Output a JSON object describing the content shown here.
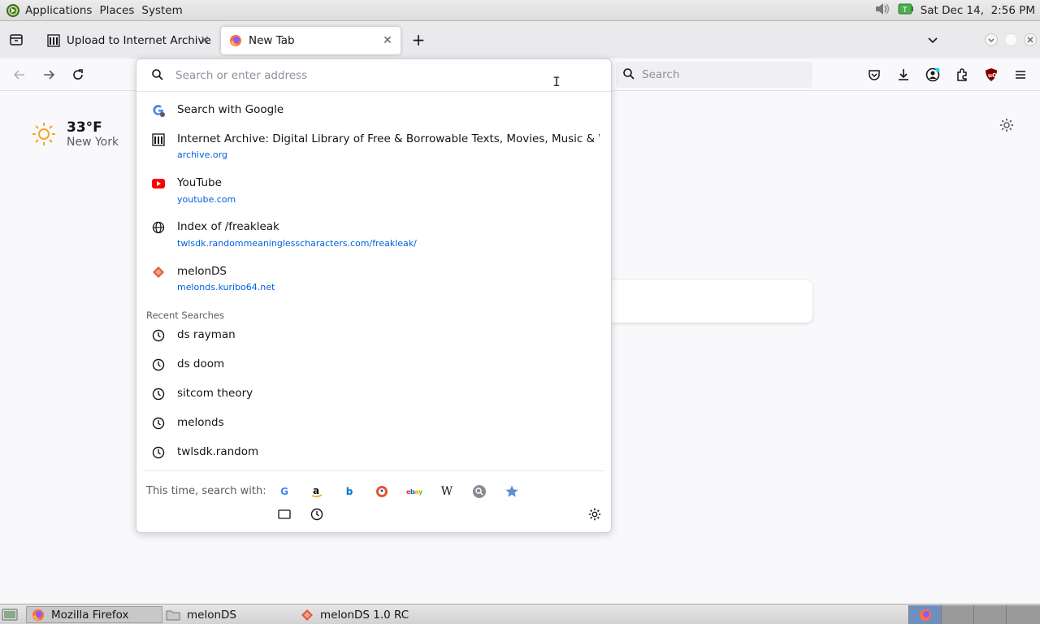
{
  "system_panel": {
    "menu": [
      "Applications",
      "Places",
      "System"
    ],
    "clock": "Sat Dec 14,  2:56 PM"
  },
  "tabs": [
    {
      "title": "Upload to Internet Archive",
      "active": false
    },
    {
      "title": "New Tab",
      "active": true
    }
  ],
  "urlbar": {
    "placeholder": "Search or enter address",
    "value": ""
  },
  "searchbar": {
    "placeholder": "Search"
  },
  "weather": {
    "temperature": "33°F",
    "city": "New York"
  },
  "suggestions": [
    {
      "title": "Search with Google",
      "url": "",
      "icon": "google-icon"
    },
    {
      "title": "Internet Archive: Digital Library of Free & Borrowable Texts, Movies, Music & Wayba",
      "url": "archive.org",
      "icon": "archive-icon"
    },
    {
      "title": "YouTube",
      "url": "youtube.com",
      "icon": "youtube-icon"
    },
    {
      "title": "Index of /freakleak",
      "url": "twlsdk.randommeaninglesscharacters.com/freakleak/",
      "icon": "globe-icon"
    },
    {
      "title": "melonDS",
      "url": "melonds.kuribo64.net",
      "icon": "melonds-icon"
    }
  ],
  "recent_searches": {
    "label": "Recent Searches",
    "items": [
      "ds rayman",
      "ds doom",
      "sitcom theory",
      "melonds",
      "twlsdk.random"
    ]
  },
  "one_off": {
    "label": "This time, search with:",
    "engines": [
      "Google",
      "Amazon",
      "Bing",
      "DuckDuckGo",
      "eBay",
      "Wikipedia",
      "Search",
      "Bookmarks"
    ]
  },
  "taskbar": {
    "items": [
      "Mozilla Firefox",
      "melonDS",
      "melonDS 1.0 RC"
    ]
  },
  "colors": {
    "accent": "#0060df",
    "youtube": "#ff0000",
    "ublock": "#800000"
  }
}
